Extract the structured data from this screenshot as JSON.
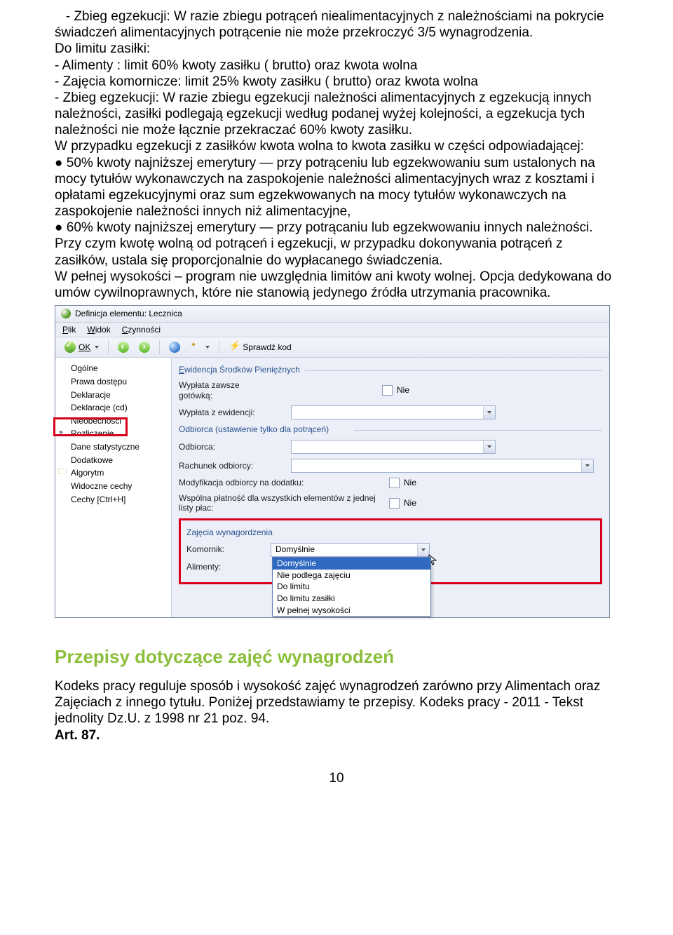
{
  "body": {
    "p1": "   - Zbieg egzekucji: W razie zbiegu potrąceń niealimentacyjnych z należnościami na pokrycie świadczeń alimentacyjnych potrącenie nie może przekroczyć 3/5 wynagrodzenia.",
    "p2": "Do limitu zasiłki:",
    "p3": "- Alimenty : limit 60% kwoty zasiłku ( brutto) oraz kwota wolna",
    "p4": "- Zajęcia komornicze: limit 25% kwoty zasiłku ( brutto) oraz kwota wolna",
    "p5": "- Zbieg egzekucji: W razie zbiegu egzekucji należności alimentacyjnych z egzekucją innych należności, zasiłki podlegają egzekucji według podanej wyżej kolejności, a egzekucja tych należności nie może łącznie przekraczać 60% kwoty zasiłku.",
    "p6": "W przypadku egzekucji z zasiłków kwota wolna to kwota zasiłku w części odpowiadającej:",
    "p7": "● 50% kwoty najniższej emerytury — przy potrąceniu lub egzekwowaniu sum ustalonych na mocy tytułów wykonawczych na zaspokojenie należności alimentacyjnych wraz z kosztami i opłatami egzekucyjnymi oraz sum egzekwowanych na mocy tytułów wykonawczych na zaspokojenie należności innych niż alimentacyjne,",
    "p8": "● 60% kwoty najniższej emerytury — przy potrącaniu lub egzekwowaniu innych należności.",
    "p9": "Przy czym kwotę wolną od potrąceń i egzekucji, w przypadku dokonywania potrąceń z zasiłków, ustala się proporcjonalnie do wypłacanego świadczenia.",
    "p10": "W pełnej wysokości – program nie uwzględnia limitów ani kwoty wolnej. Opcja dedykowana do umów cywilnoprawnych, które nie stanowią jedynego źródła utrzymania pracownika."
  },
  "window": {
    "title": "Definicja elementu: Lecznica",
    "menu": {
      "plik": "Plik",
      "widok": "Widok",
      "czynnosci": "Czynności"
    },
    "toolbar": {
      "ok": "OK",
      "sprawdz": "Sprawdź kod"
    },
    "sidebar": {
      "items": [
        "Ogólne",
        "Prawa dostępu",
        "Deklaracje",
        "Deklaracje (cd)",
        "Nieobecności",
        "Rozliczenie",
        "Dane statystyczne",
        "Dodatkowe",
        "Algorytm",
        "Widoczne cechy",
        "Cechy [Ctrl+H]"
      ]
    },
    "main": {
      "group1": "Ewidencja Środków Pieniężnych",
      "r_wyplata_gotowka": "Wypłata zawsze gotówką:",
      "r_wyplata_ewid": "Wypłata z ewidencji:",
      "group2": "Odbiorca (ustawienie tylko dla potrąceń)",
      "r_odbiorca": "Odbiorca:",
      "r_rachunek": "Rachunek odbiorcy:",
      "r_mod": "Modyfikacja odbiorcy na dodatku:",
      "r_wspolna": "Wspólna płatność dla wszystkich elementów z jednej listy płac:",
      "nie": "Nie",
      "group3": "Zajęcia wynagordzenia",
      "r_komornik": "Komornik:",
      "r_alimenty": "Alimenty:",
      "combo_val": "Domyślnie",
      "options": [
        "Domyślnie",
        "Nie podlega zajęciu",
        "Do limitu",
        "Do limitu zasiłki",
        "W pełnej wysokości"
      ]
    }
  },
  "section2": {
    "heading": "Przepisy dotyczące zajęć wynagrodzeń",
    "p1": "Kodeks pracy reguluje sposób i wysokość zajęć wynagrodzeń zarówno przy Alimentach oraz Zajęciach z innego tytułu. Poniżej przedstawiamy te przepisy. Kodeks pracy - 2011 - Tekst jednolity Dz.U. z 1998 nr 21 poz. 94.",
    "p2": "Art. 87."
  },
  "pageNumber": "10"
}
